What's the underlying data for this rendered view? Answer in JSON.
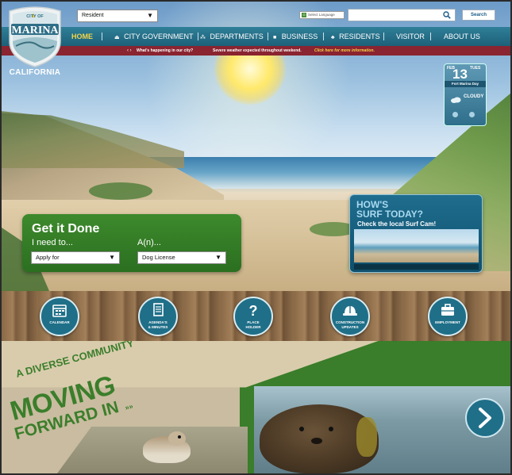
{
  "header": {
    "audience_select": "Resident",
    "language_select": "Select Language",
    "search_button": "Search"
  },
  "logo": {
    "arc_text": "CITY OF",
    "name": "MARINA",
    "state": "CALIFORNIA"
  },
  "nav": {
    "items": [
      "HOME",
      "CITY GOVERNMENT",
      "DEPARTMENTS",
      "BUSINESS",
      "RESIDENTS",
      "VISITOR",
      "ABOUT US"
    ]
  },
  "alert": {
    "lead": "What's happening in our city?",
    "message": "Severe weather expected throughout weekend.",
    "link": "Click here for more information."
  },
  "weather": {
    "month": "FEB",
    "dow": "TUES",
    "day": "13",
    "place": "Fort Marina Day",
    "condition": "CLOUDY"
  },
  "get_it_done": {
    "title": "Get it Done",
    "need_label": "I need to...",
    "need_value": "Apply for",
    "an_label": "A(n)...",
    "an_value": "Dog License"
  },
  "surf_cam": {
    "line1": "HOW'S",
    "line2": "SURF TODAY?",
    "sub": "Check the local Surf Cam!"
  },
  "quick_links": [
    {
      "line1": "CALENDAR",
      "line2": ""
    },
    {
      "line1": "AGENDA'S",
      "line2": "& MINUTES"
    },
    {
      "line1": "PLACE",
      "line2": "HOLDER"
    },
    {
      "line1": "CONSTRUCTION",
      "line2": "UPDATES"
    },
    {
      "line1": "EMPLOYMENT",
      "line2": ""
    }
  ],
  "feature": {
    "tagline1": "A DIVERSE COMMUNITY",
    "tagline2": "MOVING",
    "tagline3": "FORWARD IN",
    "tagline3_mark": "»»"
  },
  "colors": {
    "nav_bg": "#1d6079",
    "nav_active": "#f2d54a",
    "alert_bg": "#8a2430",
    "green": "#3b7e2b",
    "quick_bg": "#1f6f88"
  }
}
